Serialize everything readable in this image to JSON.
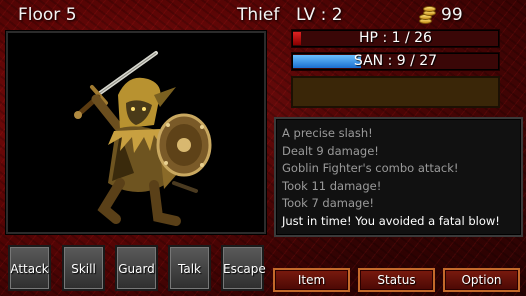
{
  "header": {
    "floor": "Floor 5",
    "job": "Thief",
    "level": "LV : 2",
    "gold": "99"
  },
  "icons": {
    "gold": "gold-coins-icon",
    "enemy": "goblin-fighter-sprite"
  },
  "stats": {
    "hp_label": "HP : 1 / 26",
    "hp_fraction": 0.0385,
    "san_label": "SAN : 9 / 27",
    "san_fraction": 0.3333
  },
  "log": [
    "A precise slash!",
    "Dealt 9 damage!",
    "Goblin Fighter's combo attack!",
    "Took 11 damage!",
    "Took 7 damage!",
    "Just in time! You avoided a fatal blow!"
  ],
  "commands": [
    "Attack",
    "Skill",
    "Guard",
    "Talk",
    "Escape"
  ],
  "menu": [
    "Item",
    "Status",
    "Option"
  ],
  "colors": {
    "hp": "#cc2222",
    "san": "#3a8ee6",
    "background": "#6a0808"
  }
}
